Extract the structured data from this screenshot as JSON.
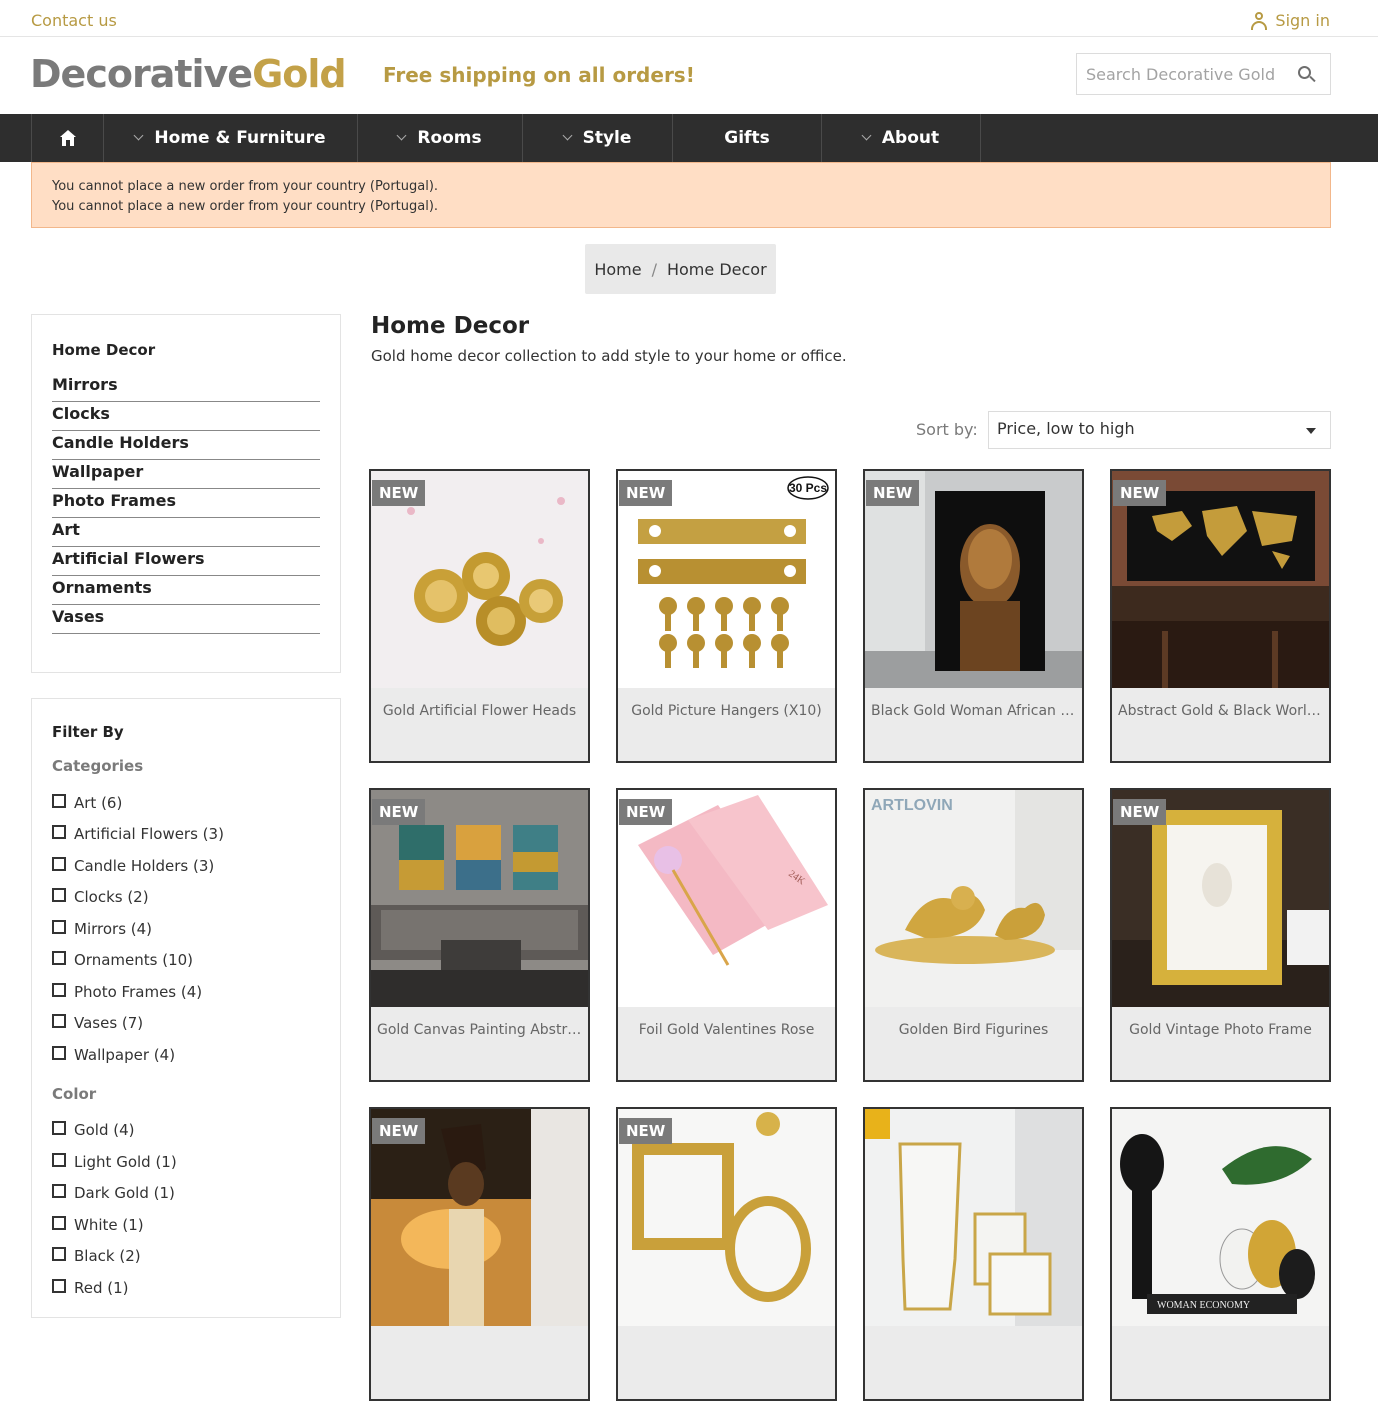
{
  "topbar": {
    "contact_label": "Contact us",
    "signin_label": "Sign in"
  },
  "header": {
    "logo_part1": "Decorative",
    "logo_part2": "Gold",
    "tagline": "Free shipping on all orders!",
    "search_placeholder": "Search Decorative Gold"
  },
  "nav": {
    "items": [
      {
        "label": "Home & Furniture"
      },
      {
        "label": "Rooms"
      },
      {
        "label": "Style"
      },
      {
        "label": "Gifts"
      },
      {
        "label": "About"
      }
    ]
  },
  "alert": {
    "line1": "You cannot place a new order from your country (Portugal).",
    "line2": "You cannot place a new order from your country (Portugal)."
  },
  "breadcrumb": {
    "home": "Home",
    "separator": "/",
    "current": "Home Decor"
  },
  "sidebar": {
    "category_title": "Home Decor",
    "categories": [
      "Mirrors",
      "Clocks",
      "Candle Holders",
      "Wallpaper",
      "Photo Frames",
      "Art",
      "Artificial Flowers",
      "Ornaments",
      "Vases"
    ],
    "filter_title": "Filter By",
    "facets": {
      "categories_title": "Categories",
      "categories": [
        "Art (6)",
        "Artificial Flowers (3)",
        "Candle Holders (3)",
        "Clocks (2)",
        "Mirrors (4)",
        "Ornaments (10)",
        "Photo Frames (4)",
        "Vases (7)",
        "Wallpaper (4)"
      ],
      "color_title": "Color",
      "colors": [
        "Gold (4)",
        "Light Gold (1)",
        "Dark Gold (1)",
        "White (1)",
        "Black (2)",
        "Red (1)"
      ]
    }
  },
  "main": {
    "title": "Home Decor",
    "description": "Gold home decor collection to add style to your home or office.",
    "sort_label": "Sort by:",
    "sort_value": "Price, low to high",
    "badge_label": "NEW",
    "products": [
      {
        "name": "Gold Artificial Flower Heads",
        "new": true
      },
      {
        "name": "Gold Picture Hangers (X10)",
        "new": true
      },
      {
        "name": "Black Gold Woman African Art",
        "new": true
      },
      {
        "name": "Abstract Gold & Black World...",
        "new": true
      },
      {
        "name": "Gold Canvas Painting Abstract",
        "new": true
      },
      {
        "name": "Foil Gold Valentines Rose",
        "new": true
      },
      {
        "name": "Golden Bird Figurines",
        "new": false
      },
      {
        "name": "Gold Vintage Photo Frame",
        "new": true
      },
      {
        "name": "",
        "new": true
      },
      {
        "name": "",
        "new": true
      },
      {
        "name": "",
        "new": false
      },
      {
        "name": "",
        "new": false
      }
    ],
    "image_texts": {
      "pcs": "30 Pcs",
      "artlovin": "ARTLOVIN",
      "rose_box": "24K",
      "magazine": "WOMAN ECONOMY"
    }
  },
  "colors": {
    "accent": "#b79a43",
    "nav_bg": "#2e2e2e",
    "alert_bg": "#ffdec5",
    "badge_bg": "#7a7a7a"
  }
}
